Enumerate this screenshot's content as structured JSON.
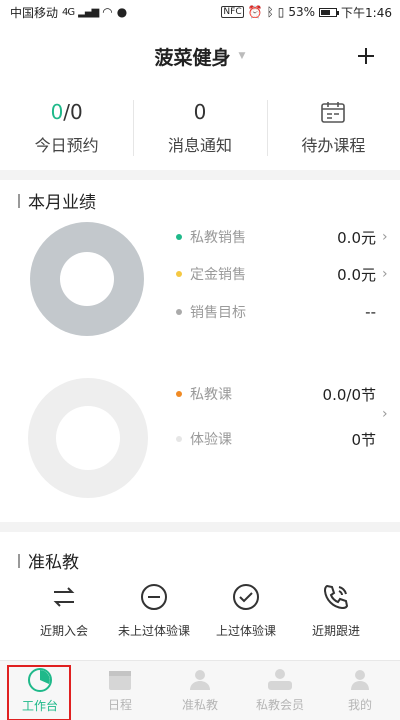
{
  "statusbar": {
    "carrier": "中国移动",
    "network": "4G",
    "nfc": "NFC",
    "battery": "53%",
    "time": "下午1:46"
  },
  "header": {
    "title": "菠菜健身",
    "add_icon": "plus-icon"
  },
  "summary": [
    {
      "value_main": "0",
      "value_rest": "/0",
      "label": "今日预约"
    },
    {
      "value": "0",
      "label": "消息通知"
    },
    {
      "label": "待办课程",
      "icon": "calendar-icon"
    }
  ],
  "performance": {
    "title": "本月业绩",
    "sales_rows": [
      {
        "name": "私教销售",
        "value": "0.0元",
        "color": "#1fb98a"
      },
      {
        "name": "定金销售",
        "value": "0.0元",
        "color": "#f5c842"
      },
      {
        "name": "销售目标",
        "value": "--",
        "color": "#aaaaaa"
      }
    ],
    "course_rows": [
      {
        "name": "私教课",
        "value": "0.0/0节",
        "color": "#f08a24"
      },
      {
        "name": "体验课",
        "value": "0节",
        "color": "#e6e6e6"
      }
    ],
    "donut1_color": "#c3c8cc",
    "donut2_color": "#eeeeee"
  },
  "quasi": {
    "title": "准私教",
    "actions": [
      {
        "label": "近期入会",
        "icon": "swap-arrows-icon"
      },
      {
        "label": "未上过体验课",
        "icon": "minus-circle-icon"
      },
      {
        "label": "上过体验课",
        "icon": "check-circle-icon"
      },
      {
        "label": "近期跟进",
        "icon": "phone-icon"
      }
    ]
  },
  "tabbar": [
    {
      "label": "工作台",
      "icon": "pie-chart-icon",
      "active": true
    },
    {
      "label": "日程",
      "icon": "calendar-icon"
    },
    {
      "label": "准私教",
      "icon": "person-icon"
    },
    {
      "label": "私教会员",
      "icon": "vip-person-icon"
    },
    {
      "label": "我的",
      "icon": "profile-icon"
    }
  ]
}
